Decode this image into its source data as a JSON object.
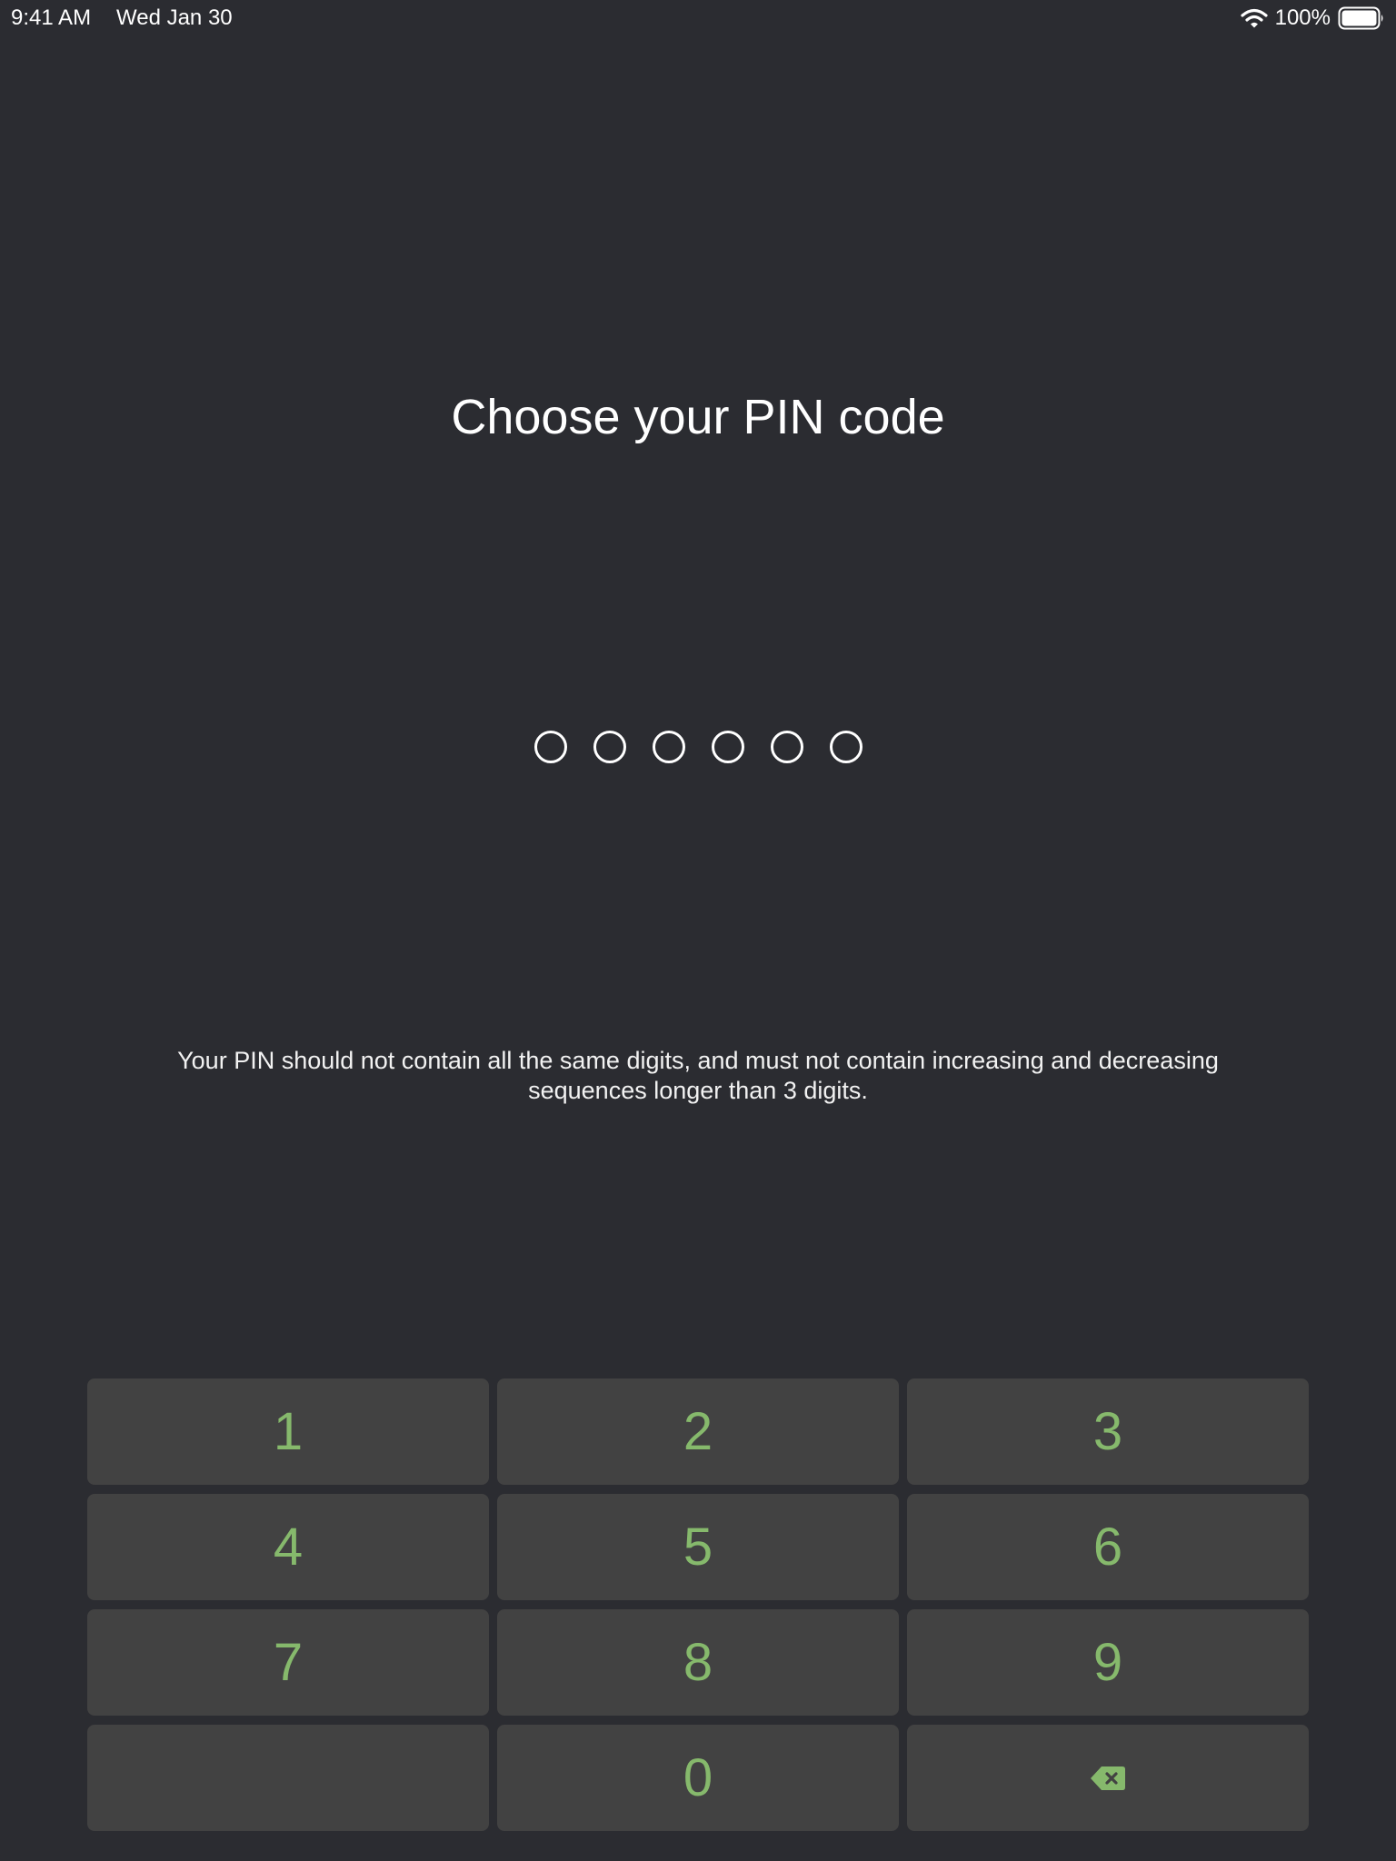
{
  "status_bar": {
    "time": "9:41 AM",
    "date": "Wed Jan 30",
    "battery_percent": "100%",
    "wifi_icon": "wifi-icon",
    "battery_icon": "battery-icon"
  },
  "screen": {
    "title": "Choose your PIN code",
    "pin_length": 6,
    "pin_entered": 0,
    "hint": "Your PIN should not contain all the same digits, and must not contain increasing and decreasing sequences longer than 3 digits."
  },
  "keypad": {
    "k1": "1",
    "k2": "2",
    "k3": "3",
    "k4": "4",
    "k5": "5",
    "k6": "6",
    "k7": "7",
    "k8": "8",
    "k9": "9",
    "k0": "0",
    "backspace_icon": "backspace-icon"
  },
  "colors": {
    "background": "#2b2c31",
    "key_background": "#424242",
    "key_text": "#86b96c",
    "text": "#ffffff"
  }
}
